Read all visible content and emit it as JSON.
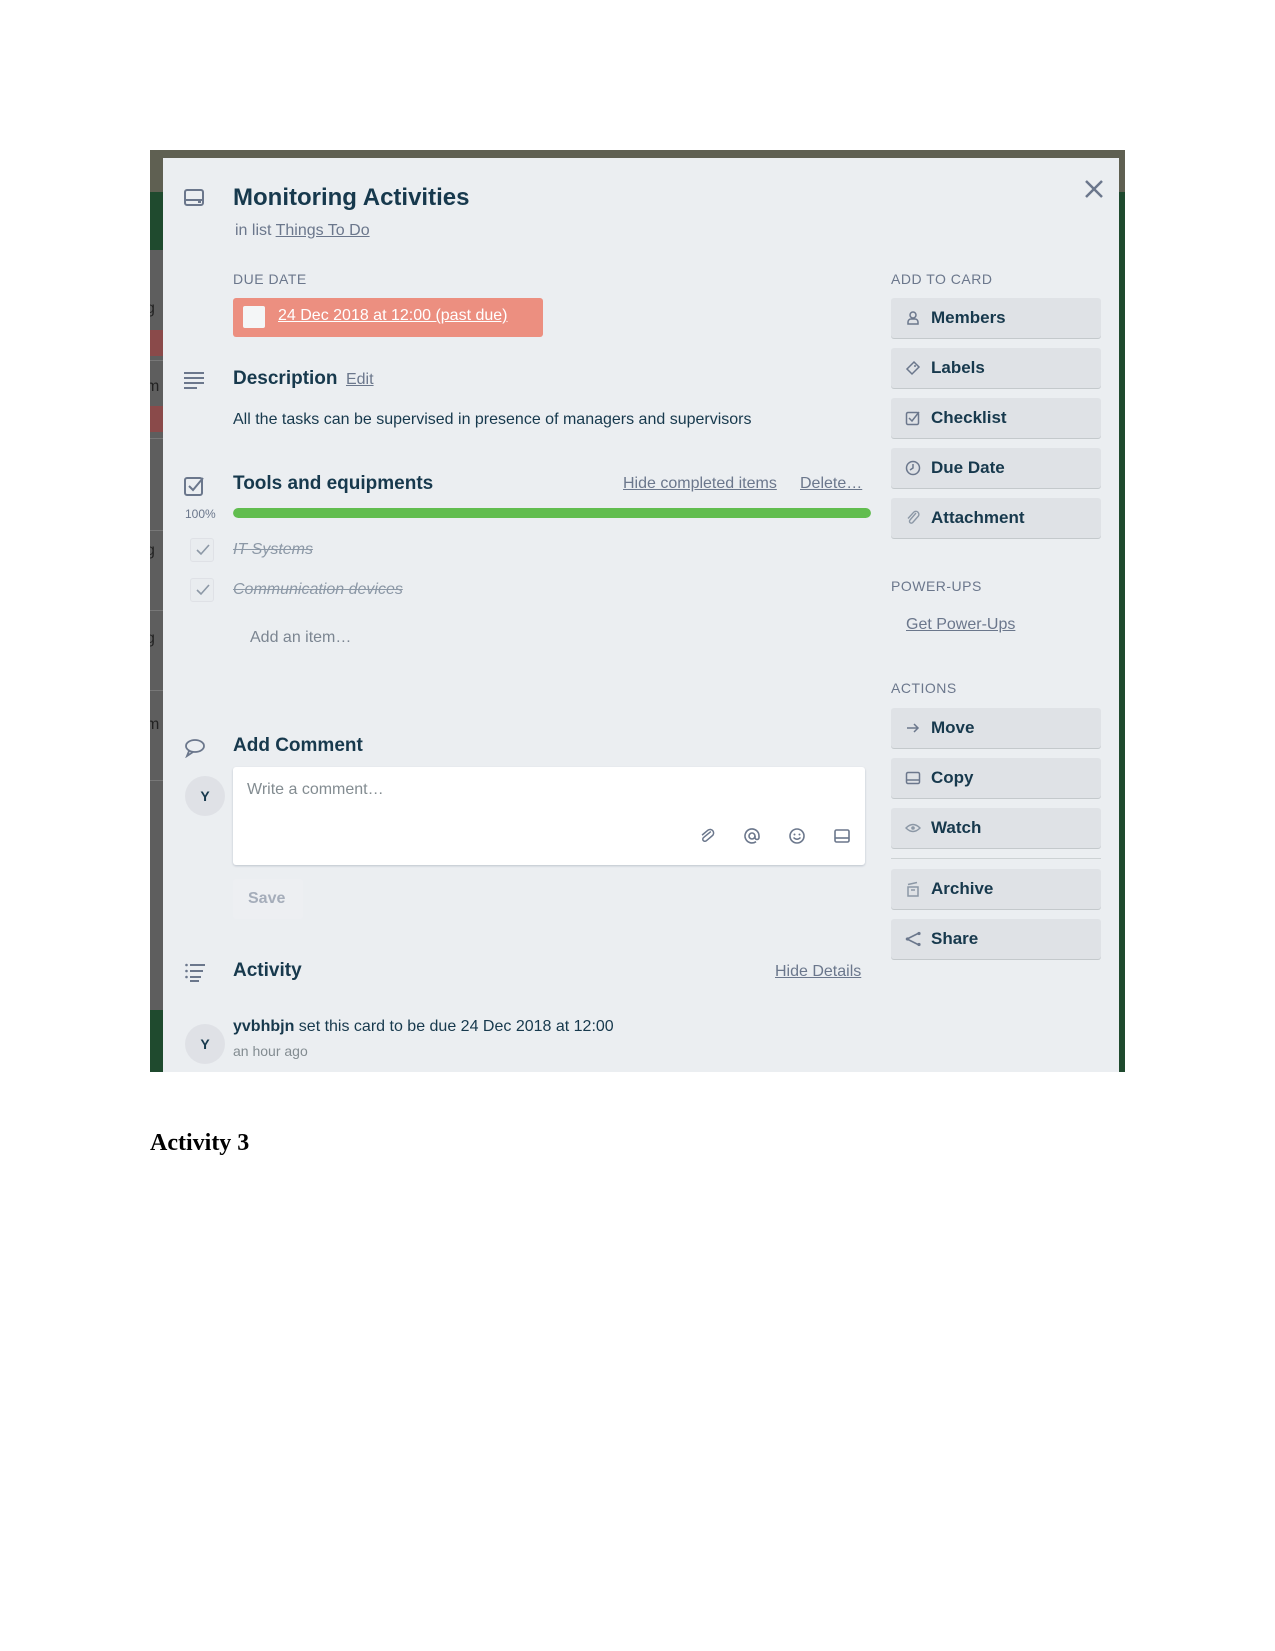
{
  "card": {
    "title": "Monitoring Activities",
    "in_list_prefix": "in list",
    "list_name": "Things To Do",
    "close_icon": "close-icon",
    "due_date": {
      "label": "Due Date",
      "value": "24 Dec 2018 at 12:00 (past due)",
      "status_color": "#ec8f80",
      "completed": false
    },
    "description": {
      "heading": "Description",
      "edit_label": "Edit",
      "text": "All the tasks can be supervised in presence of managers and supervisors"
    },
    "checklist": {
      "heading": "Tools and equipments",
      "hide_completed_label": "Hide completed items",
      "delete_label": "Delete…",
      "progress_label": "100%",
      "progress": 1.0,
      "progress_color": "#61bd4f",
      "items": [
        {
          "text": "IT Systems",
          "checked": true
        },
        {
          "text": "Communication devices",
          "checked": true
        }
      ],
      "add_item_label": "Add an item…"
    },
    "comment": {
      "heading": "Add Comment",
      "avatar_initial": "Y",
      "placeholder": "Write a comment…",
      "tools": [
        "attachment-icon",
        "mention-icon",
        "emoji-icon",
        "card-icon"
      ],
      "save_label": "Save"
    },
    "activity": {
      "heading": "Activity",
      "hide_details_label": "Hide Details",
      "entries": [
        {
          "avatar_initial": "Y",
          "user": "yvbhbjn",
          "action": "set this card to be due 24 Dec 2018 at 12:00",
          "time": "an hour ago"
        }
      ]
    }
  },
  "sidebar": {
    "add_to_card_label": "Add to Card",
    "add_to_card": [
      {
        "label": "Members",
        "icon": "person-icon"
      },
      {
        "label": "Labels",
        "icon": "tag-icon"
      },
      {
        "label": "Checklist",
        "icon": "checklist-icon"
      },
      {
        "label": "Due Date",
        "icon": "clock-icon"
      },
      {
        "label": "Attachment",
        "icon": "paperclip-icon"
      }
    ],
    "power_ups_label": "Power-Ups",
    "get_power_ups_label": "Get Power-Ups",
    "actions_label": "Actions",
    "actions": [
      {
        "label": "Move",
        "icon": "arrow-right-icon"
      },
      {
        "label": "Copy",
        "icon": "card-icon"
      },
      {
        "label": "Watch",
        "icon": "eye-icon"
      },
      {
        "label": "Archive",
        "icon": "archive-icon"
      },
      {
        "label": "Share",
        "icon": "share-icon"
      }
    ]
  },
  "document": {
    "heading": "Activity 3"
  }
}
